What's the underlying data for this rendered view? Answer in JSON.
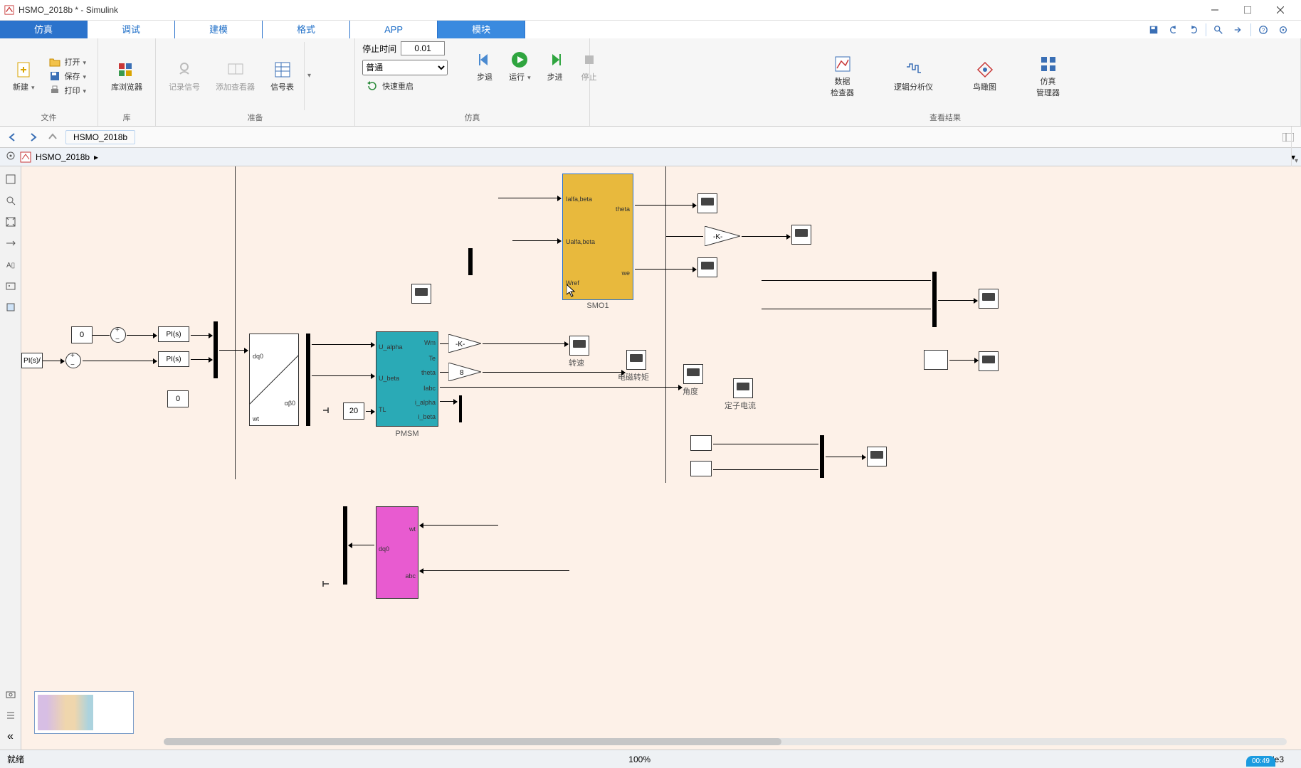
{
  "window": {
    "title": "HSMO_2018b * - Simulink"
  },
  "tabs": {
    "sim": "仿真",
    "debug": "调试",
    "model": "建模",
    "format": "格式",
    "app": "APP",
    "module": "模块"
  },
  "qat": {
    "save": "save",
    "undo": "undo",
    "redo": "redo",
    "zoom": "zoom",
    "find": "find",
    "help": "help",
    "target": "target"
  },
  "ribbon": {
    "file": {
      "new": "新建",
      "open": "打开",
      "save": "保存",
      "print": "打印",
      "label": "文件"
    },
    "lib": {
      "browser": "库浏览器",
      "label": "库"
    },
    "prep": {
      "record": "记录信号",
      "viewer": "添加查看器",
      "signaltable": "信号表",
      "label": "准备"
    },
    "sim": {
      "stoptime_label": "停止时间",
      "stoptime_value": "0.01",
      "speed_value": "普通",
      "fastreset": "快速重启",
      "stepback": "步退",
      "run": "运行",
      "stepfwd": "步进",
      "stop": "停止",
      "label": "仿真"
    },
    "results": {
      "data": "数据\n检查器",
      "logic": "逻辑分析仪",
      "birdseye": "鸟瞰图",
      "mgr": "仿真\n管理器",
      "label": "查看结果"
    }
  },
  "nav": {
    "crumb": "HSMO_2018b"
  },
  "path": {
    "root": "HSMO_2018b"
  },
  "blocks": {
    "smo1": {
      "name": "SMO1",
      "in1": "Ialfa,beta",
      "in2": "Ualfa,beta",
      "in3": "Wref",
      "out1": "theta",
      "out2": "we"
    },
    "pmsm": {
      "name": "PMSM",
      "in1": "U_alpha",
      "in2": "U_beta",
      "in3": "TL",
      "out1": "Wm",
      "out2": "Te",
      "out3": "theta",
      "out4": "Iabc",
      "out5": "i_alpha",
      "out6": "i_beta"
    },
    "dq0_1": {
      "top": "dq0",
      "bot": "αβ0",
      "wt": "wt"
    },
    "dq0_2": {
      "top": "dq0",
      "bot": "abc",
      "wt": "wt"
    },
    "pi1": "PI(s)",
    "pi2": "PI(s)",
    "pi0": "PI(s)/",
    "c0": "0",
    "c1": "0",
    "c20": "20",
    "gainK": "-K-",
    "gain8": "8",
    "gainK2": "-K-",
    "label_speed": "转速",
    "label_torque": "电磁转矩",
    "label_angle": "角度",
    "label_stator": "定子电流"
  },
  "status": {
    "ready": "就绪",
    "zoom": "100%",
    "solver": "ode3",
    "timer": "00:49"
  }
}
